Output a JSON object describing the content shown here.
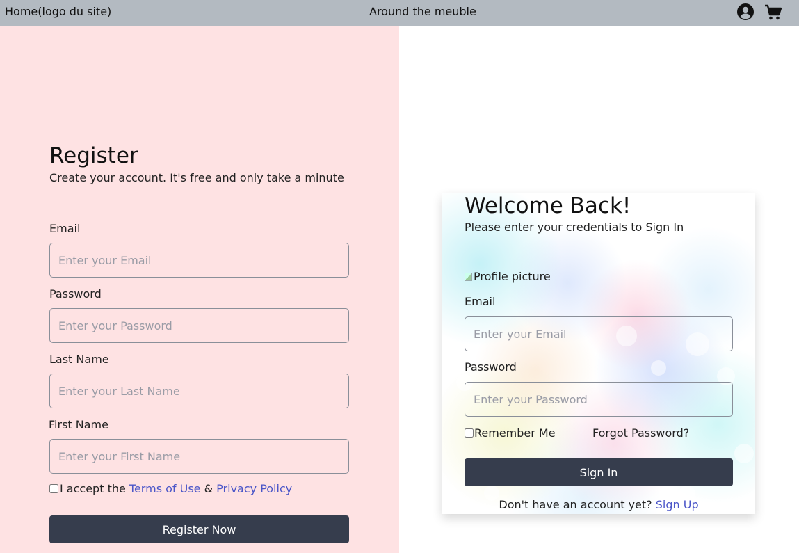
{
  "nav": {
    "home": "Home(logo du site)",
    "title": "Around the meuble",
    "user_icon": "user-circle-icon",
    "cart_icon": "shopping-cart-icon"
  },
  "register": {
    "title": "Register",
    "subtitle": "Create your account. It's free and only take a minute",
    "email_label": "Email",
    "email_placeholder": "Enter your Email",
    "password_label": "Password",
    "password_placeholder": "Enter your Password",
    "lastname_label": "Last Name",
    "lastname_placeholder": "Enter your Last Name",
    "firstname_label": "First Name",
    "firstname_placeholder": "Enter your First Name",
    "terms_prefix": "I accept the ",
    "terms_link": "Terms of Use",
    "terms_and": " & ",
    "privacy_link": "Privacy Policy",
    "button": "Register Now"
  },
  "signin": {
    "title": "Welcome Back!",
    "subtitle": "Please enter your credentials to Sign In",
    "profile_alt": "Profile picture",
    "email_label": "Email",
    "email_placeholder": "Enter your Email",
    "password_label": "Password",
    "password_placeholder": "Enter your Password",
    "remember": "Remember Me",
    "forgot": "Forgot Password?",
    "button": "Sign In",
    "footer_text": "Don't have an account yet? ",
    "signup_link": "Sign Up"
  },
  "colors": {
    "nav_bg": "#b3bac1",
    "register_bg": "#fee2e3",
    "button_bg": "#363d4d",
    "link": "#4b56c8"
  }
}
